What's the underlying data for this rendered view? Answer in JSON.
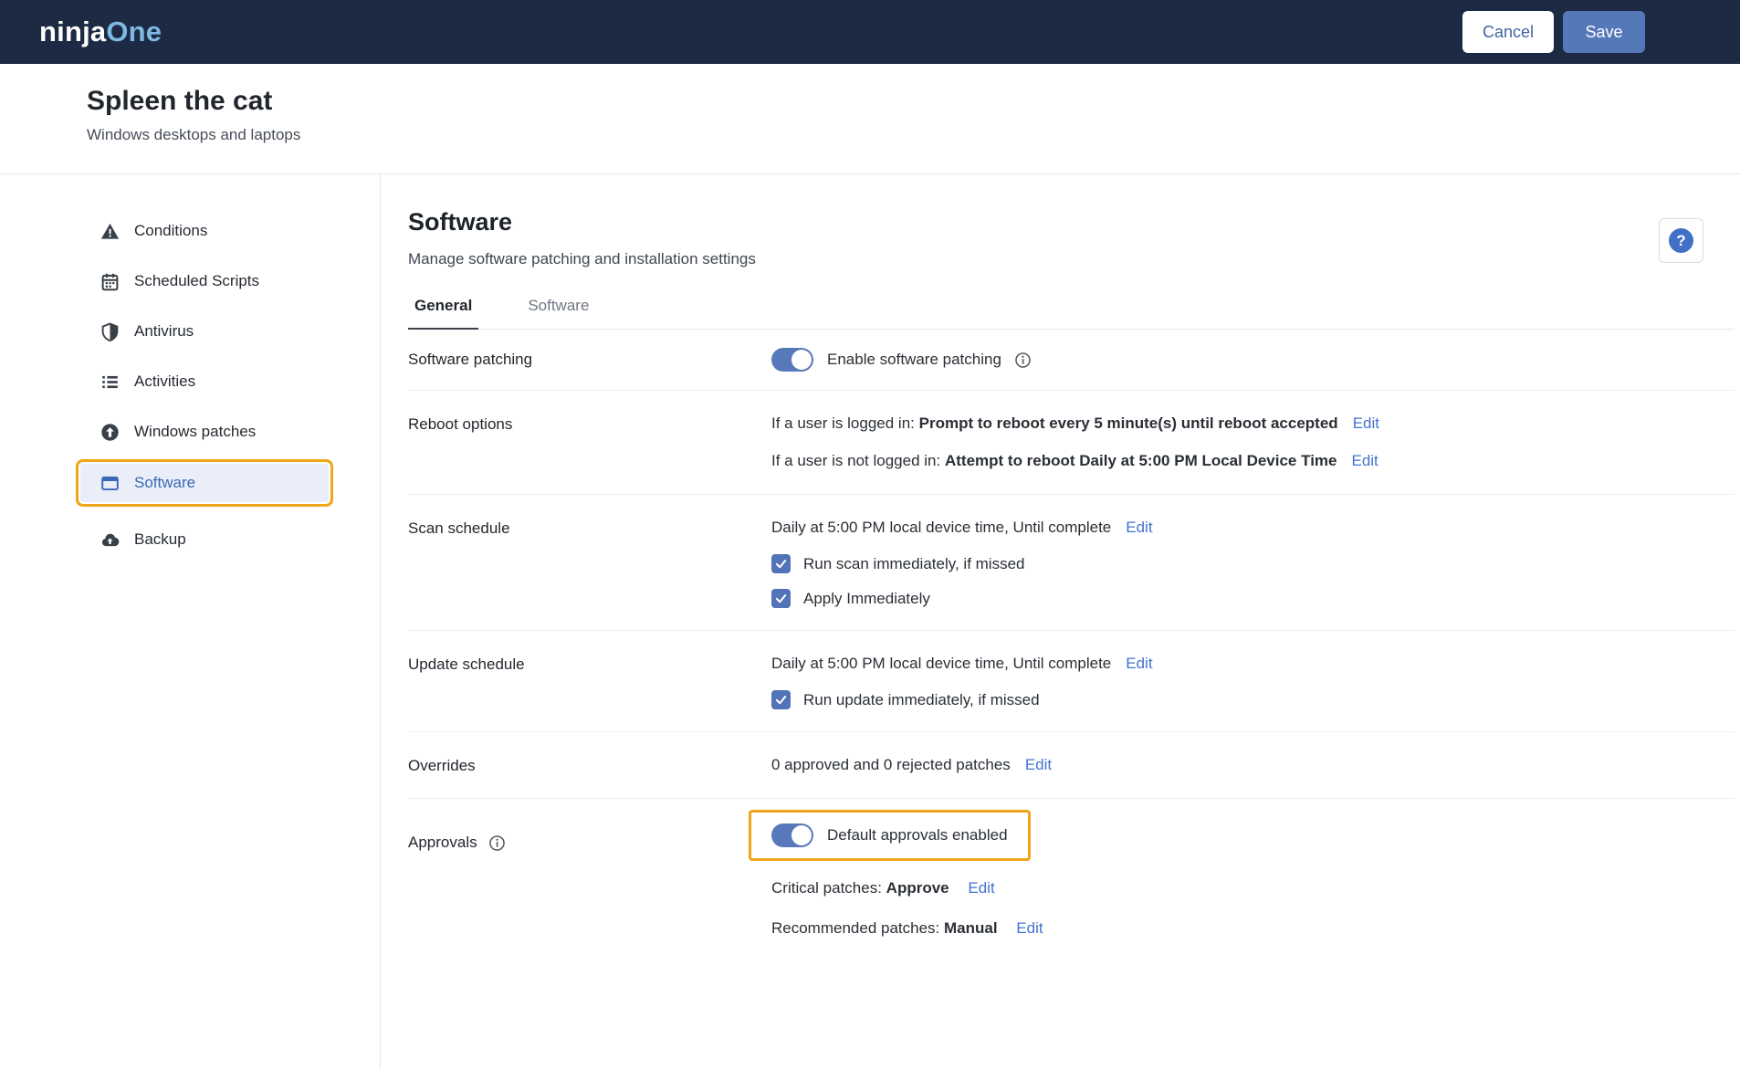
{
  "colors": {
    "topbar_bg": "#1d2a44",
    "accent_blue": "#5779ba",
    "link_blue": "#4472cf",
    "highlight_orange": "#f0a61a",
    "selected_item_bg": "#e9eef8",
    "logo_blue": "#7fb8e2"
  },
  "header": {
    "logo": {
      "ninja": "ninja",
      "one": "One"
    },
    "cancel_label": "Cancel",
    "save_label": "Save"
  },
  "device": {
    "name": "Spleen the cat",
    "subtitle": "Windows desktops and laptops"
  },
  "sidebar": {
    "items": [
      {
        "label": "Conditions",
        "icon": "warning-triangle-icon",
        "active": false
      },
      {
        "label": "Scheduled Scripts",
        "icon": "calendar-icon",
        "active": false
      },
      {
        "label": "Antivirus",
        "icon": "shield-icon",
        "active": false
      },
      {
        "label": "Activities",
        "icon": "list-icon",
        "active": false
      },
      {
        "label": "Windows patches",
        "icon": "arrow-up-circle-icon",
        "active": false
      },
      {
        "label": "Software",
        "icon": "window-icon",
        "active": true,
        "highlighted": true
      },
      {
        "label": "Backup",
        "icon": "cloud-upload-icon",
        "active": false
      }
    ]
  },
  "main": {
    "title": "Software",
    "subtitle": "Manage software patching and installation settings",
    "help_label": "?",
    "tabs": [
      {
        "label": "General",
        "active": true
      },
      {
        "label": "Software",
        "active": false
      }
    ],
    "rows": {
      "software_patching": {
        "label": "Software patching",
        "toggle_on": true,
        "toggle_label": "Enable software patching"
      },
      "reboot_options": {
        "label": "Reboot options",
        "line1_prefix": "If a user is logged in: ",
        "line1_value": "Prompt to reboot every 5 minute(s) until reboot accepted",
        "line2_prefix": "If a user is not logged in: ",
        "line2_value": "Attempt to reboot Daily at 5:00 PM Local Device Time",
        "edit_label": "Edit"
      },
      "scan_schedule": {
        "label": "Scan schedule",
        "value": "Daily at 5:00 PM local device time, Until complete",
        "edit_label": "Edit",
        "checkboxes": [
          {
            "label": "Run scan immediately, if missed",
            "checked": true
          },
          {
            "label": "Apply Immediately",
            "checked": true
          }
        ]
      },
      "update_schedule": {
        "label": "Update schedule",
        "value": "Daily at 5:00 PM local device time, Until complete",
        "edit_label": "Edit",
        "checkboxes": [
          {
            "label": "Run update immediately, if missed",
            "checked": true
          }
        ]
      },
      "overrides": {
        "label": "Overrides",
        "value": "0 approved and 0 rejected patches",
        "edit_label": "Edit"
      },
      "approvals": {
        "label": "Approvals",
        "toggle_on": true,
        "toggle_label": "Default approvals enabled",
        "critical_prefix": "Critical patches: ",
        "critical_value": "Approve",
        "recommended_prefix": "Recommended patches: ",
        "recommended_value": "Manual",
        "edit_label": "Edit"
      }
    }
  }
}
